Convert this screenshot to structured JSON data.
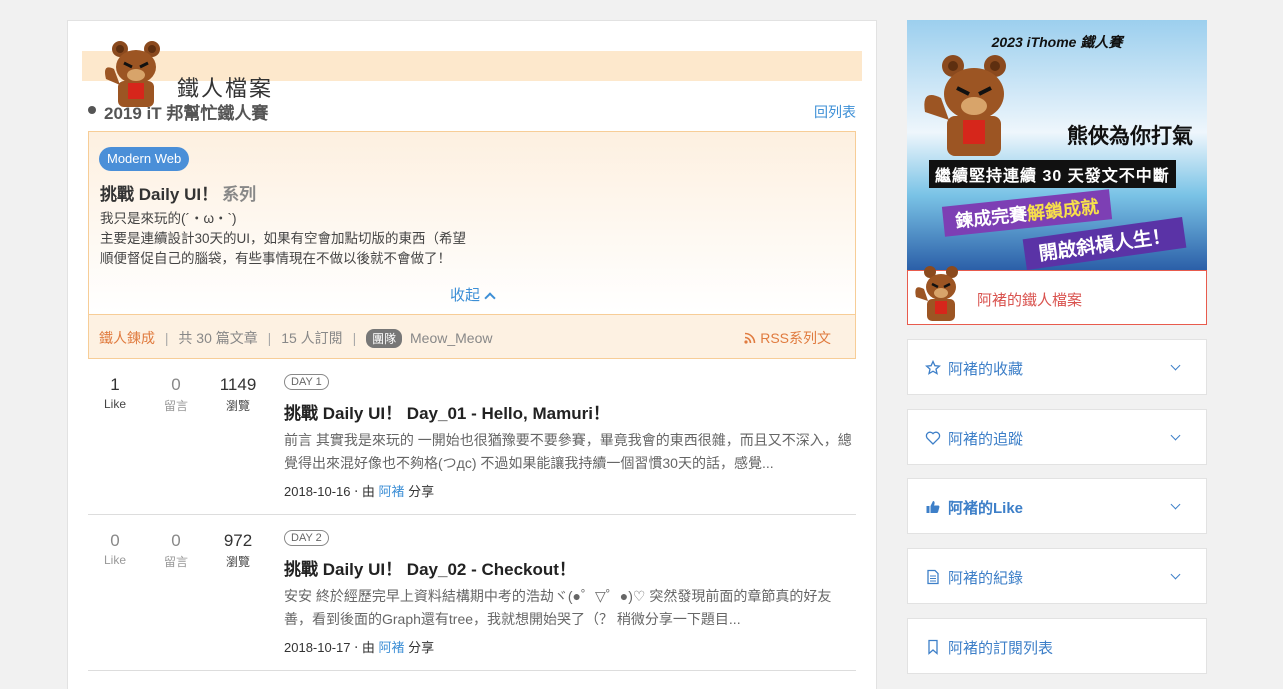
{
  "profile": {
    "title": "鐵人檔案"
  },
  "series": {
    "contest": "2019 iT 邦幫忙鐵人賽",
    "back_label": "回列表",
    "category_tag": "Modern Web",
    "title": "挑戰 Daily UI！",
    "title_suffix": "系列",
    "description": [
      "我只是來玩的(´・ω・`)",
      "主要是連續設計30天的UI，如果有空會加點切版的東西（希望",
      "順便督促自己的腦袋，有些事情現在不做以後就不會做了！"
    ],
    "collapse_label": "收起",
    "status": "鐵人鍊成",
    "article_count": "共 30 篇文章",
    "subscribers": "15 人訂閱",
    "team_badge": "團隊",
    "team_name": "Meow_Meow",
    "rss_label": "RSS系列文",
    "separator": "|"
  },
  "articles": [
    {
      "likes": "1",
      "likes_label": "Like",
      "comments": "0",
      "comments_label": "留言",
      "views": "1149",
      "views_label": "瀏覽",
      "day": "DAY 1",
      "title": "挑戰 Daily UI！ Day_01 - Hello, Mamuri！",
      "excerpt": "前言 其實我是來玩的 一開始也很猶豫要不要參賽，畢竟我會的東西很雜，而且又不深入，總覺得出來混好像也不夠格(つдc) 不過如果能讓我持續一個習慣30天的話，感覺...",
      "date": "2018-10-16",
      "by": "‧ 由",
      "author": "阿褚",
      "share": "分享"
    },
    {
      "likes": "0",
      "likes_label": "Like",
      "comments": "0",
      "comments_label": "留言",
      "views": "972",
      "views_label": "瀏覽",
      "day": "DAY 2",
      "title": "挑戰 Daily UI！ Day_02 - Checkout！",
      "excerpt": "安安 終於經歷完早上資料結構期中考的浩劫ヾ(●゜▽゜●)♡ 突然發現前面的章節真的好友善，看到後面的Graph還有tree，我就想開始哭了（？ 稍微分享一下題目...",
      "date": "2018-10-17",
      "by": "‧ 由",
      "author": "阿褚",
      "share": "分享"
    }
  ],
  "banner": {
    "top": "2023 iThome 鐵人賽",
    "slogan": "熊俠為你打氣",
    "sub": "繼續堅持連續 30 天發文不中斷",
    "r1_a": "鍊成完賽",
    "r1_b": "解鎖成就",
    "r2": "開啟斜槓人生！"
  },
  "sidebar": {
    "profile_link": "阿褚的鐵人檔案",
    "items": [
      {
        "label": "阿褚的收藏",
        "icon": "star-icon"
      },
      {
        "label": "阿褚的追蹤",
        "icon": "heart-icon"
      },
      {
        "label": "阿褚的Like",
        "icon": "thumbs-up-icon"
      },
      {
        "label": "阿褚的紀錄",
        "icon": "document-icon"
      },
      {
        "label": "阿褚的訂閱列表",
        "icon": "bookmark-icon"
      }
    ]
  },
  "colors": {
    "accent_blue": "#3d8fd6",
    "accent_orange": "#e07b3f",
    "profile_bar": "#fde8cc",
    "profile_link_border": "#e85b4d"
  }
}
